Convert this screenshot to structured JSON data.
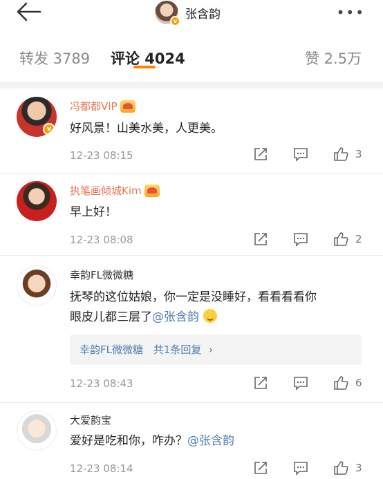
{
  "header": {
    "back_icon": "arrow-left-icon",
    "title": "张含韵",
    "more_icon": "more-dots-icon",
    "badge": "v"
  },
  "tabs": [
    {
      "label": "转发 3789",
      "active": false
    },
    {
      "label": "评论 4024",
      "active": true
    },
    {
      "label": "赞 2.5万",
      "active": false
    }
  ],
  "colors": {
    "accent": "#ff8200",
    "vip_name": "#eb7350",
    "mention": "#507daf"
  },
  "comments": [
    {
      "name": "冯都都VIP",
      "vip": true,
      "text": "好风景！山美水美，人更美。",
      "time": "12-23 08:15",
      "likes": "3"
    },
    {
      "name": "执笔画倾城Kim",
      "vip": true,
      "text": "早上好！",
      "time": "12-23 08:08",
      "likes": "2"
    },
    {
      "name": "幸韵FL微微糖",
      "vip": false,
      "text_line1": "抚琴的这位姑娘，你一定是没睡好，看看看看你",
      "text_line2": "眼皮儿都三层了",
      "mention": "@张含韵",
      "reply_name": "幸韵FL微微糖",
      "reply_count": "共1条回复",
      "reply_arrow": "›",
      "time": "12-23 08:43",
      "likes": "6"
    },
    {
      "name": "大爱韵宝",
      "vip": false,
      "text": "爱好是吃和你，咋办？",
      "mention": "@张含韵",
      "time": "12-23 08:14",
      "likes": "3"
    }
  ]
}
